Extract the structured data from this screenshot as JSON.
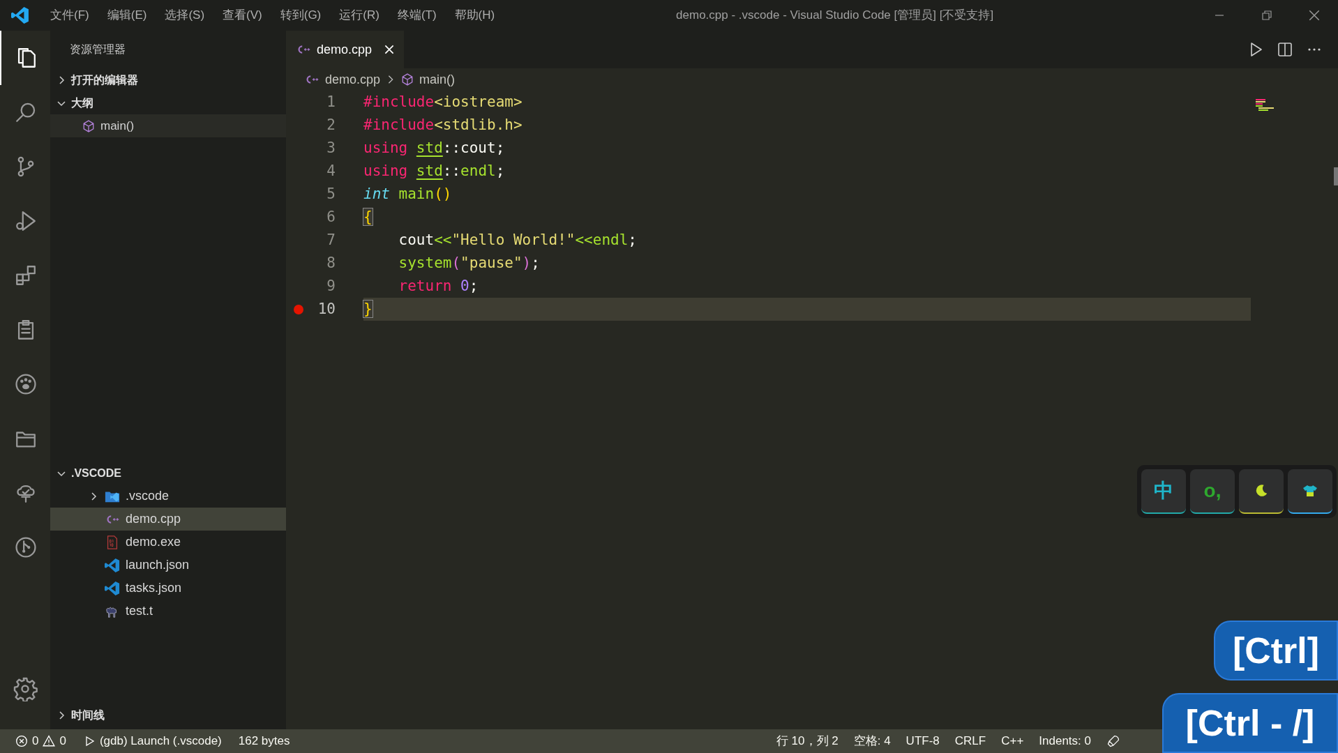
{
  "menu": [
    "文件(F)",
    "编辑(E)",
    "选择(S)",
    "查看(V)",
    "转到(G)",
    "运行(R)",
    "终端(T)",
    "帮助(H)"
  ],
  "window": {
    "title": "demo.cpp - .vscode - Visual Studio Code [管理员] [不受支持]"
  },
  "activity_bar": [
    {
      "kind": "files",
      "selected": true
    },
    {
      "kind": "search",
      "selected": false
    },
    {
      "kind": "source-control",
      "selected": false
    },
    {
      "kind": "run",
      "selected": false
    },
    {
      "kind": "extensions",
      "selected": false
    },
    {
      "kind": "clipboard",
      "selected": false
    },
    {
      "kind": "paw",
      "selected": false
    },
    {
      "kind": "folder",
      "selected": false
    },
    {
      "kind": "tree",
      "selected": false
    },
    {
      "kind": "git-graph",
      "selected": false
    }
  ],
  "sidebar": {
    "title": "资源管理器",
    "sections": [
      {
        "title": "打开的编辑器",
        "expanded": false
      },
      {
        "title": "大纲",
        "expanded": true,
        "items": [
          {
            "label": "main()",
            "kind": "function"
          }
        ]
      },
      {
        "title": ".VSCODE",
        "expanded": true,
        "files": [
          {
            "label": ".vscode",
            "kind": "folder",
            "expanded": false,
            "selected": false
          },
          {
            "label": "demo.cpp",
            "kind": "cpp",
            "selected": true
          },
          {
            "label": "demo.exe",
            "kind": "exe",
            "selected": false
          },
          {
            "label": "launch.json",
            "kind": "vscode",
            "selected": false
          },
          {
            "label": "tasks.json",
            "kind": "vscode",
            "selected": false
          },
          {
            "label": "test.t",
            "kind": "perl",
            "selected": false
          }
        ]
      },
      {
        "title": "时间线",
        "expanded": false
      }
    ]
  },
  "tabs": [
    {
      "label": "demo.cpp",
      "selected": true
    }
  ],
  "breadcrumb": [
    "demo.cpp",
    "main()"
  ],
  "code": [
    {
      "number": "1",
      "breakpoint": false,
      "current": false,
      "tokens": [
        {
          "text": "#include",
          "kind": "keyword"
        },
        {
          "text": "<iostream>",
          "kind": "string"
        }
      ]
    },
    {
      "number": "2",
      "breakpoint": false,
      "current": false,
      "tokens": [
        {
          "text": "#include",
          "kind": "keyword"
        },
        {
          "text": "<stdlib.h>",
          "kind": "string"
        }
      ]
    },
    {
      "number": "3",
      "breakpoint": false,
      "current": false,
      "tokens": [
        {
          "text": "using ",
          "kind": "keyword"
        },
        {
          "text": "std",
          "kind": "namespace"
        },
        {
          "text": "::cout;",
          "kind": "plain"
        }
      ]
    },
    {
      "number": "4",
      "breakpoint": false,
      "current": false,
      "tokens": [
        {
          "text": "using ",
          "kind": "keyword"
        },
        {
          "text": "std",
          "kind": "namespace"
        },
        {
          "text": "::",
          "kind": "plain"
        },
        {
          "text": "endl",
          "kind": "function"
        },
        {
          "text": ";",
          "kind": "plain"
        }
      ]
    },
    {
      "number": "5",
      "breakpoint": false,
      "current": false,
      "tokens": [
        {
          "text": "int ",
          "kind": "type"
        },
        {
          "text": "main",
          "kind": "function"
        },
        {
          "text": "()",
          "kind": "bracket"
        }
      ]
    },
    {
      "number": "6",
      "breakpoint": false,
      "current": false,
      "tokens": [
        {
          "text": "{",
          "kind": "bracket_match"
        }
      ]
    },
    {
      "number": "7",
      "breakpoint": false,
      "current": false,
      "tokens": [
        {
          "text": "    cout",
          "kind": "plain"
        },
        {
          "text": "<<",
          "kind": "keyword_green"
        },
        {
          "text": "\"Hello World!\"",
          "kind": "string"
        },
        {
          "text": "<<endl",
          "kind": "keyword_green"
        },
        {
          "text": ";",
          "kind": "plain"
        }
      ]
    },
    {
      "number": "8",
      "breakpoint": false,
      "current": false,
      "tokens": [
        {
          "text": "    system",
          "kind": "function"
        },
        {
          "text": "(",
          "kind": "paren"
        },
        {
          "text": "\"pause\"",
          "kind": "string"
        },
        {
          "text": ")",
          "kind": "paren"
        },
        {
          "text": ";",
          "kind": "plain"
        }
      ]
    },
    {
      "number": "9",
      "breakpoint": false,
      "current": false,
      "tokens": [
        {
          "text": "    return ",
          "kind": "keyword"
        },
        {
          "text": "0",
          "kind": "number"
        },
        {
          "text": ";",
          "kind": "plain"
        }
      ]
    },
    {
      "number": "10",
      "breakpoint": true,
      "current": true,
      "tokens": [
        {
          "text": "}",
          "kind": "bracket_match"
        }
      ]
    }
  ],
  "ime_toolbar": [
    "中",
    "o,"
  ],
  "key_overlays": [
    "[Ctrl]",
    "[Ctrl - /]"
  ],
  "status_bar": {
    "errors": "0",
    "warnings": "0",
    "launch": "(gdb) Launch (.vscode)",
    "size": "162 bytes",
    "right": [
      "行 10，列 2",
      "空格: 4",
      "UTF-8",
      "CRLF",
      "C++",
      "Indents: 0"
    ]
  }
}
